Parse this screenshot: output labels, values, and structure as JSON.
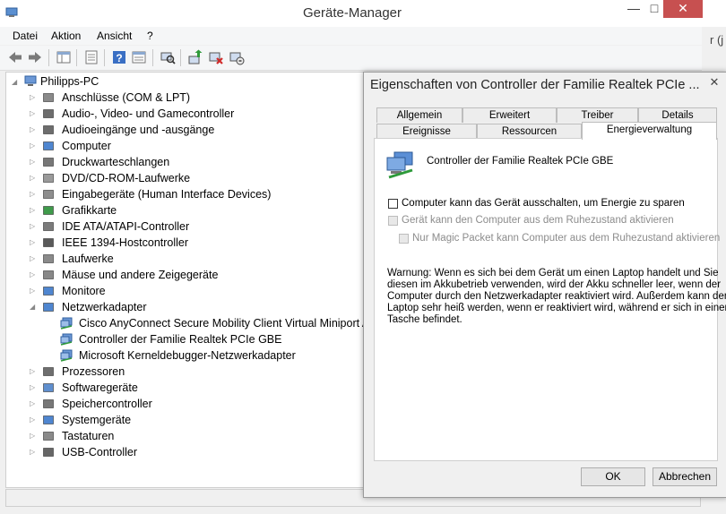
{
  "window": {
    "title": "Geräte-Manager",
    "minimize_glyph": "—",
    "maximize_glyph": "□",
    "close_glyph": "✕",
    "right_edge_text": "r (j"
  },
  "menu": [
    "Datei",
    "Aktion",
    "Ansicht",
    "?"
  ],
  "toolbar": [
    "back-arrow-icon",
    "forward-arrow-icon",
    "show-hide-tree-icon",
    "properties-icon",
    "help-icon",
    "view-icon",
    "scan-hardware-icon",
    "update-driver-icon",
    "uninstall-icon",
    "disable-device-icon"
  ],
  "tree": {
    "root": "Philipps-PC",
    "categories": [
      {
        "label": "Anschlüsse (COM & LPT)",
        "icon": "port-icon"
      },
      {
        "label": "Audio-, Video- und Gamecontroller",
        "icon": "speaker-icon"
      },
      {
        "label": "Audioeingänge und -ausgänge",
        "icon": "speaker-icon"
      },
      {
        "label": "Computer",
        "icon": "monitor-icon"
      },
      {
        "label": "Druckwarteschlangen",
        "icon": "printer-icon"
      },
      {
        "label": "DVD/CD-ROM-Laufwerke",
        "icon": "disc-icon"
      },
      {
        "label": "Eingabegeräte (Human Interface Devices)",
        "icon": "hid-icon"
      },
      {
        "label": "Grafikkarte",
        "icon": "display-adapter-icon"
      },
      {
        "label": "IDE ATA/ATAPI-Controller",
        "icon": "ide-icon"
      },
      {
        "label": "IEEE 1394-Hostcontroller",
        "icon": "firewire-icon"
      },
      {
        "label": "Laufwerke",
        "icon": "drive-icon"
      },
      {
        "label": "Mäuse und andere Zeigegeräte",
        "icon": "mouse-icon"
      },
      {
        "label": "Monitore",
        "icon": "monitor-icon"
      },
      {
        "label": "Netzwerkadapter",
        "icon": "network-icon",
        "expanded": true,
        "children": [
          "Cisco AnyConnect Secure Mobility Client Virtual Miniport Adapter",
          "Controller der Familie Realtek PCIe GBE",
          "Microsoft Kerneldebugger-Netzwerkadapter"
        ]
      },
      {
        "label": "Prozessoren",
        "icon": "cpu-icon"
      },
      {
        "label": "Softwaregeräte",
        "icon": "software-device-icon"
      },
      {
        "label": "Speichercontroller",
        "icon": "storage-icon"
      },
      {
        "label": "Systemgeräte",
        "icon": "system-icon"
      },
      {
        "label": "Tastaturen",
        "icon": "keyboard-icon"
      },
      {
        "label": "USB-Controller",
        "icon": "usb-icon"
      }
    ]
  },
  "dialog": {
    "title": "Eigenschaften von Controller der Familie Realtek PCIe ...",
    "close_glyph": "✕",
    "tabs_row1": [
      "Allgemein",
      "Erweitert",
      "Treiber",
      "Details"
    ],
    "tabs_row2": [
      "Ereignisse",
      "Ressourcen",
      "Energieverwaltung"
    ],
    "active_tab": "Energieverwaltung",
    "device_name": "Controller der Familie Realtek PCIe GBE",
    "options": [
      {
        "label": "Computer kann das Gerät ausschalten, um Energie zu sparen",
        "checked": false,
        "enabled": true
      },
      {
        "label": "Gerät kann den Computer aus dem Ruhezustand aktivieren",
        "checked": false,
        "enabled": false
      },
      {
        "label": "Nur Magic Packet kann Computer aus dem Ruhezustand aktivieren",
        "checked": false,
        "enabled": false
      }
    ],
    "warning_lines": [
      "Warnung: Wenn es sich bei dem Gerät um einen Laptop handelt und Sie",
      "diesen im Akkubetrieb verwenden, wird der Akku schneller leer, wenn der",
      "Computer durch den Netzwerkadapter reaktiviert wird. Außerdem kann der",
      "Laptop sehr heiß werden, wenn er reaktiviert wird, während er sich in einer",
      "Tasche befindet."
    ],
    "ok_label": "OK",
    "cancel_label": "Abbrechen"
  },
  "colors": {
    "close_button": "#c75050",
    "selection_blue": "#3a74c9"
  }
}
